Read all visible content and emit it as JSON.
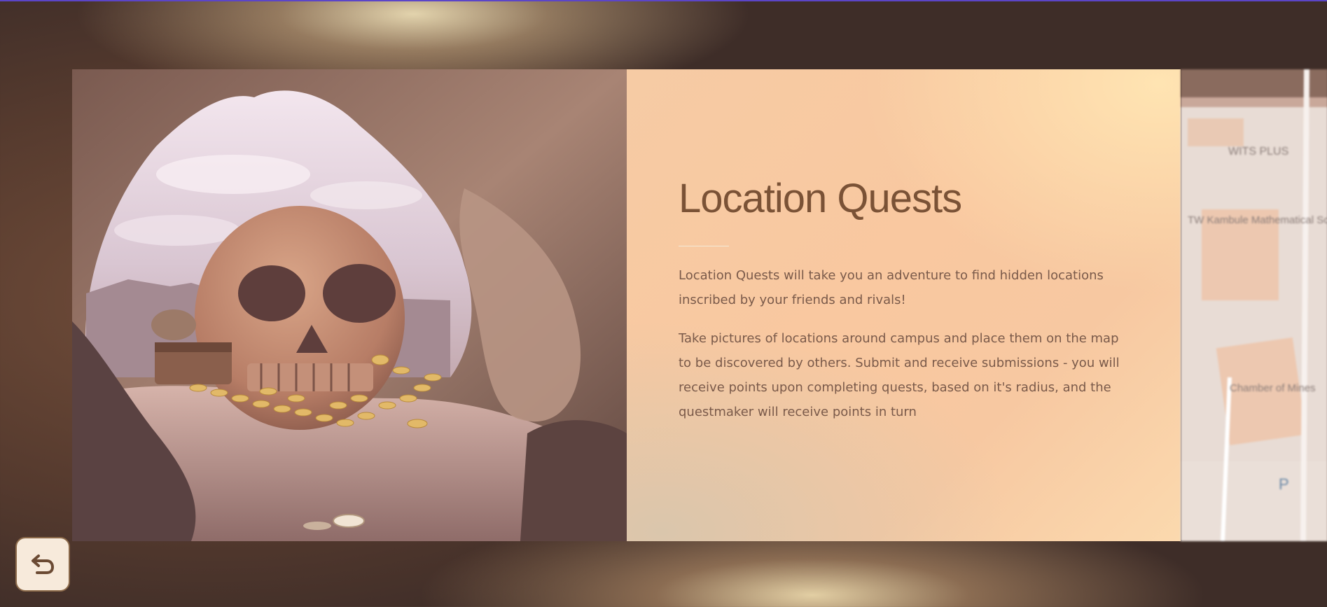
{
  "quest_intro": {
    "title": "Location Quests",
    "paragraphs": [
      "Location Quests will take you an adventure to find hidden locations inscribed by your friends and rivals!",
      "Take pictures of locations around campus and place them on the map to be discovered by others. Submit and receive submissions - you will receive points upon completing quests, based on it's radius, and the questmaker will receive points in turn"
    ]
  },
  "map_preview": {
    "labels": [
      "WITS PLUS",
      "TW Kambule Mathematical Sciences Building",
      "Chamber of Mines",
      "P"
    ]
  },
  "navigation": {
    "back_icon": "return-arrow-icon"
  },
  "colors": {
    "accent_top_line": "#5b45c8",
    "title": "#7a5236",
    "panel_background": "#f9c8a0"
  }
}
